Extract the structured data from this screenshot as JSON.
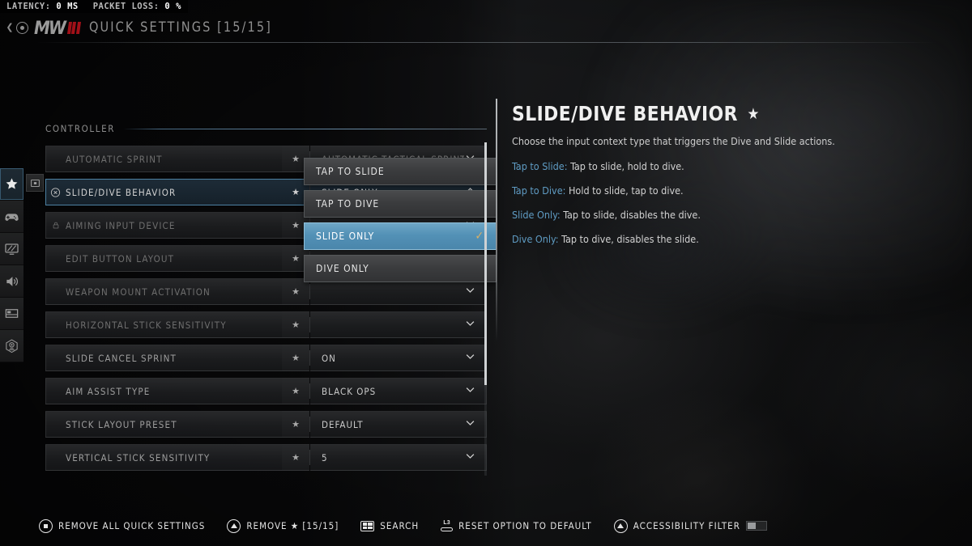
{
  "netstatus": {
    "latency_label": "LATENCY:",
    "latency_value": "0",
    "latency_unit": "MS",
    "packetloss_label": "PACKET LOSS:",
    "packetloss_value": "0",
    "packetloss_unit": "%"
  },
  "header": {
    "logo_mw": "MW",
    "logo_numeral": "III",
    "title": "QUICK SETTINGS [15/15]"
  },
  "sidebar": {
    "items": [
      {
        "name": "favorites",
        "icon": "star-icon",
        "active": true
      },
      {
        "name": "controller",
        "icon": "gamepad-icon",
        "active": false
      },
      {
        "name": "graphics",
        "icon": "monitor-icon",
        "active": false
      },
      {
        "name": "audio",
        "icon": "speaker-icon",
        "active": false
      },
      {
        "name": "interface",
        "icon": "interface-icon",
        "active": false
      },
      {
        "name": "accessibility",
        "icon": "accessibility-icon",
        "active": false
      }
    ],
    "float_icon": "screen-swap-icon"
  },
  "settings": {
    "section_title": "CONTROLLER",
    "rows": [
      {
        "label": "AUTOMATIC SPRINT",
        "value": "AUTOMATIC TACTICAL SPRINT",
        "starred": true,
        "selected": false,
        "dim": true,
        "lead_icon": ""
      },
      {
        "label": "SLIDE/DIVE BEHAVIOR",
        "value": "SLIDE ONLY",
        "starred": true,
        "selected": true,
        "dim": false,
        "lead_icon": "cross-circle-icon"
      },
      {
        "label": "AIMING INPUT DEVICE",
        "value": "",
        "starred": true,
        "selected": false,
        "dim": true,
        "lead_icon": "lock-icon"
      },
      {
        "label": "EDIT BUTTON LAYOUT",
        "value": "",
        "starred": true,
        "selected": false,
        "dim": true,
        "lead_icon": ""
      },
      {
        "label": "WEAPON MOUNT ACTIVATION",
        "value": "",
        "starred": true,
        "selected": false,
        "dim": true,
        "lead_icon": ""
      },
      {
        "label": "HORIZONTAL STICK SENSITIVITY",
        "value": "",
        "starred": true,
        "selected": false,
        "dim": true,
        "lead_icon": ""
      },
      {
        "label": "SLIDE CANCEL SPRINT",
        "value": "ON",
        "starred": true,
        "selected": false,
        "dim": false,
        "lead_icon": ""
      },
      {
        "label": "AIM ASSIST TYPE",
        "value": "BLACK OPS",
        "starred": true,
        "selected": false,
        "dim": false,
        "lead_icon": ""
      },
      {
        "label": "STICK LAYOUT PRESET",
        "value": "DEFAULT",
        "starred": true,
        "selected": false,
        "dim": false,
        "lead_icon": ""
      },
      {
        "label": "VERTICAL STICK SENSITIVITY",
        "value": "5",
        "starred": true,
        "selected": false,
        "dim": false,
        "lead_icon": ""
      }
    ]
  },
  "dropdown": {
    "open": true,
    "selected_value": "SLIDE ONLY",
    "options": [
      {
        "label": "TAP TO SLIDE",
        "selected": false
      },
      {
        "label": "TAP TO DIVE",
        "selected": false
      },
      {
        "label": "SLIDE ONLY",
        "selected": true
      },
      {
        "label": "DIVE ONLY",
        "selected": false
      }
    ]
  },
  "detail": {
    "title": "SLIDE/DIVE BEHAVIOR",
    "favorited": true,
    "description": "Choose the input context type that triggers the Dive and Slide actions.",
    "bullets": [
      {
        "key": "Tap to Slide:",
        "text": " Tap to slide, hold to dive."
      },
      {
        "key": "Tap to Dive:",
        "text": " Hold to slide, tap to dive."
      },
      {
        "key": "Slide Only:",
        "text": " Tap to slide, disables the dive."
      },
      {
        "key": "Dive Only:",
        "text": " Tap to dive, disables the slide."
      }
    ]
  },
  "footer": {
    "items": [
      {
        "button": "circle-button-icon",
        "label": "REMOVE ALL QUICK SETTINGS"
      },
      {
        "button": "triangle-button-icon",
        "label": "REMOVE ★ [15/15]"
      },
      {
        "button": "touchpad-button-icon",
        "label": "SEARCH"
      },
      {
        "button": "l3-button-icon",
        "label": "RESET OPTION TO DEFAULT"
      },
      {
        "button": "triangle-button-icon",
        "label": "ACCESSIBILITY FILTER",
        "toggle": "off"
      }
    ]
  },
  "colors": {
    "accent_blue": "#5391b6",
    "key_blue": "#5f9cc4",
    "check_gold": "#d9b066",
    "logo_red": "#a11018",
    "rule_blue": "#6f9fc2"
  }
}
